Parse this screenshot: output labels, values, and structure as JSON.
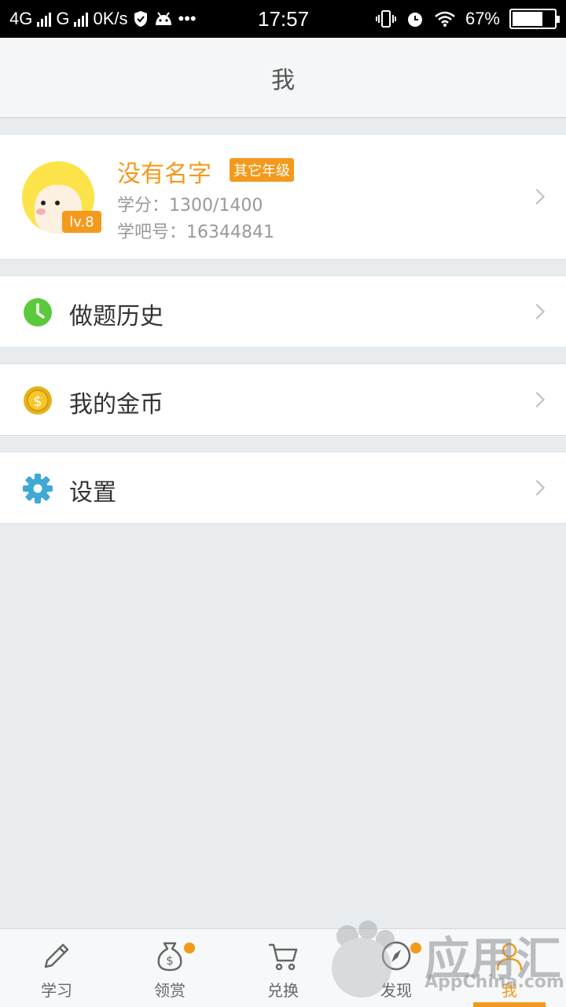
{
  "status_bar": {
    "network": "4G",
    "carrier2": "G",
    "speed": "0K/s",
    "time": "17:57",
    "battery": "67%"
  },
  "header": {
    "title": "我"
  },
  "profile": {
    "name": "没有名字",
    "grade": "其它年级",
    "level": "lv.8",
    "credits": "学分：1300/1400",
    "id_line": "学吧号：16344841"
  },
  "menu": {
    "items": [
      {
        "label": "做题历史",
        "icon": "clock-icon",
        "color": "#5cc93c"
      },
      {
        "label": "我的金币",
        "icon": "coin-icon",
        "color": "#e6b21a"
      },
      {
        "label": "设置",
        "icon": "gear-icon",
        "color": "#3fa9d6"
      }
    ]
  },
  "tabbar": {
    "tabs": [
      {
        "label": "学习",
        "icon": "pencil-icon"
      },
      {
        "label": "领赏",
        "icon": "money-bag-icon"
      },
      {
        "label": "兑换",
        "icon": "cart-icon"
      },
      {
        "label": "发现",
        "icon": "compass-icon"
      },
      {
        "label": "我",
        "icon": "person-icon"
      }
    ],
    "active_index": 4,
    "accent": "#f39a1c"
  },
  "watermark": {
    "brand": "应用汇",
    "site": "AppChina.com"
  }
}
